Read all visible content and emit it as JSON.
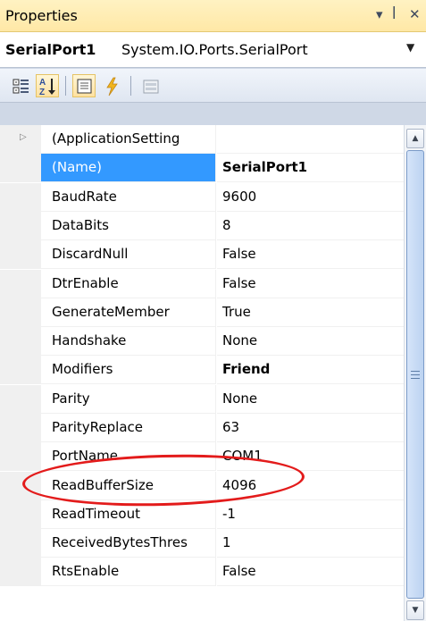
{
  "panel": {
    "title": "Properties",
    "title_icons": [
      "dropdown-arrow-icon",
      "pin-icon",
      "close-icon"
    ]
  },
  "object_selector": {
    "name": "SerialPort1",
    "type": "System.IO.Ports.SerialPort"
  },
  "toolbar": {
    "buttons": [
      "categorized-icon",
      "alphabetical-icon",
      "properties-icon",
      "events-icon",
      "property-pages-icon"
    ],
    "active": "alphabetical-icon"
  },
  "grid": {
    "rows": [
      {
        "name": "(ApplicationSetting",
        "value": "",
        "expandable": true
      },
      {
        "name": "(Name)",
        "value": "SerialPort1",
        "bold": true,
        "selected": true
      },
      {
        "name": "BaudRate",
        "value": "9600"
      },
      {
        "name": "DataBits",
        "value": "8"
      },
      {
        "name": "DiscardNull",
        "value": "False"
      },
      {
        "name": "DtrEnable",
        "value": "False"
      },
      {
        "name": "GenerateMember",
        "value": "True"
      },
      {
        "name": "Handshake",
        "value": "None"
      },
      {
        "name": "Modifiers",
        "value": "Friend",
        "bold": true
      },
      {
        "name": "Parity",
        "value": "None"
      },
      {
        "name": "ParityReplace",
        "value": "63"
      },
      {
        "name": "PortName",
        "value": "COM1"
      },
      {
        "name": "ReadBufferSize",
        "value": "4096"
      },
      {
        "name": "ReadTimeout",
        "value": "-1"
      },
      {
        "name": "ReceivedBytesThres",
        "value": "1"
      },
      {
        "name": "RtsEnable",
        "value": "False"
      }
    ]
  },
  "annotation": {
    "color": "#e31b1b",
    "target": "PortName"
  },
  "colors": {
    "selection": "#3399ff",
    "title_bar": "#ffe8a6",
    "margin": "#f0f0f0"
  }
}
